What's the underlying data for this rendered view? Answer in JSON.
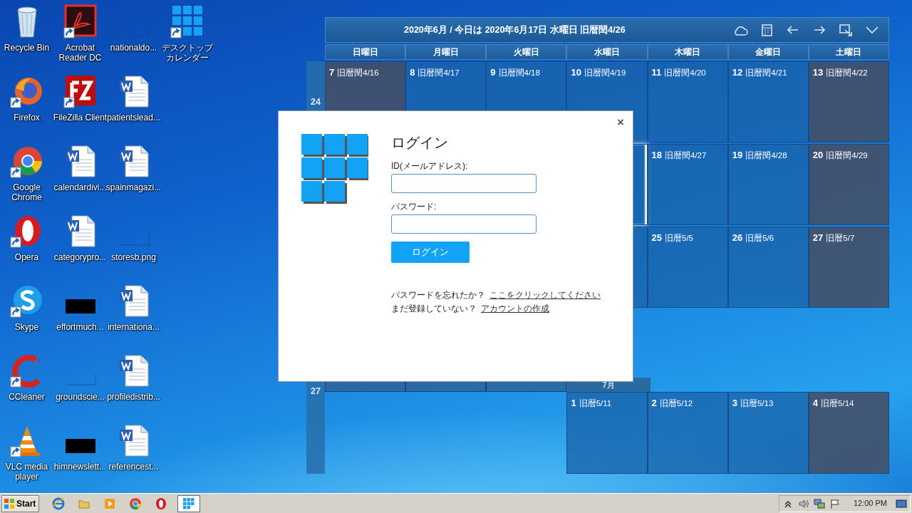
{
  "desktop_icons": [
    {
      "label": "Recycle Bin",
      "kind": "recycle",
      "shortcut": false
    },
    {
      "label": "Firefox",
      "kind": "firefox",
      "shortcut": true
    },
    {
      "label": "Google Chrome",
      "kind": "chrome",
      "shortcut": true
    },
    {
      "label": "Opera",
      "kind": "opera",
      "shortcut": true
    },
    {
      "label": "Skype",
      "kind": "skype",
      "shortcut": true
    },
    {
      "label": "CCleaner",
      "kind": "ccleaner",
      "shortcut": true
    },
    {
      "label": "VLC media player",
      "kind": "vlc",
      "shortcut": true
    },
    {
      "label": "Acrobat Reader DC",
      "kind": "pdf",
      "shortcut": true
    },
    {
      "label": "FileZilla Client",
      "kind": "filezilla",
      "shortcut": true
    },
    {
      "label": "calendardivi...",
      "kind": "word",
      "shortcut": false
    },
    {
      "label": "categorypro...",
      "kind": "word",
      "shortcut": false
    },
    {
      "label": "effortmuch...",
      "kind": "black",
      "shortcut": false
    },
    {
      "label": "groundscie...",
      "kind": "blank",
      "shortcut": false
    },
    {
      "label": "himnewslett...",
      "kind": "black",
      "shortcut": false
    },
    {
      "label": "nationaldo...",
      "kind": "blank",
      "shortcut": false
    },
    {
      "label": "patientslead...",
      "kind": "word",
      "shortcut": false
    },
    {
      "label": "spainmagazi...",
      "kind": "word",
      "shortcut": false
    },
    {
      "label": "storesb.png",
      "kind": "blank",
      "shortcut": false
    },
    {
      "label": "internationa...",
      "kind": "word",
      "shortcut": false
    },
    {
      "label": "profiledistrib...",
      "kind": "word",
      "shortcut": false
    },
    {
      "label": "referencest...",
      "kind": "word",
      "shortcut": false
    },
    {
      "label": "デスクトップカレンダー",
      "kind": "grid",
      "shortcut": true
    }
  ],
  "calendar": {
    "title": "2020年6月 / 今日は 2020年6月17日 水曜日 旧暦閏4/26",
    "weekdays": [
      "日曜日",
      "月曜日",
      "火曜日",
      "水曜日",
      "木曜日",
      "金曜日",
      "土曜日"
    ],
    "weeks": [
      {
        "week": "24",
        "strip": false,
        "days": [
          {
            "kind": "day",
            "day": "7",
            "lunar": "旧暦閏4/16",
            "weekend": true
          },
          {
            "kind": "day",
            "day": "8",
            "lunar": "旧暦閏4/17",
            "weekend": false
          },
          {
            "kind": "day",
            "day": "9",
            "lunar": "旧暦閏4/18",
            "weekend": false
          },
          {
            "kind": "day",
            "day": "10",
            "lunar": "旧暦閏4/19",
            "weekend": false
          },
          {
            "kind": "day",
            "day": "11",
            "lunar": "旧暦閏4/20",
            "weekend": false
          },
          {
            "kind": "day",
            "day": "12",
            "lunar": "旧暦閏4/21",
            "weekend": false
          },
          {
            "kind": "day",
            "day": "13",
            "lunar": "旧暦閏4/22",
            "weekend": true
          }
        ]
      },
      {
        "strip": false,
        "days": [
          {
            "kind": "covered"
          },
          {
            "kind": "covered"
          },
          {
            "kind": "covered"
          },
          {
            "kind": "covered",
            "today": true
          },
          {
            "kind": "day",
            "day": "18",
            "lunar": "旧暦閏4/27",
            "weekend": false
          },
          {
            "kind": "day",
            "day": "19",
            "lunar": "旧暦閏4/28",
            "weekend": false
          },
          {
            "kind": "day",
            "day": "20",
            "lunar": "旧暦閏4/29",
            "weekend": true
          }
        ]
      },
      {
        "strip": false,
        "days": [
          {
            "kind": "covered"
          },
          {
            "kind": "covered"
          },
          {
            "kind": "covered"
          },
          {
            "kind": "covered"
          },
          {
            "kind": "day",
            "day": "25",
            "lunar": "旧暦5/5",
            "weekend": false
          },
          {
            "kind": "day",
            "day": "26",
            "lunar": "旧暦5/6",
            "weekend": false
          },
          {
            "kind": "day",
            "day": "27",
            "lunar": "旧暦5/7",
            "weekend": true
          }
        ]
      },
      {
        "week": "27",
        "strip": true,
        "days": [
          {
            "kind": "blank"
          },
          {
            "kind": "blank"
          },
          {
            "kind": "blank"
          },
          {
            "kind": "day",
            "day": "1",
            "lunar": "旧暦5/11",
            "weekend": false,
            "month_label": "7月"
          },
          {
            "kind": "day",
            "day": "2",
            "lunar": "旧暦5/12",
            "weekend": false
          },
          {
            "kind": "day",
            "day": "3",
            "lunar": "旧暦5/13",
            "weekend": false
          },
          {
            "kind": "day",
            "day": "4",
            "lunar": "旧暦5/14",
            "weekend": true
          }
        ]
      }
    ]
  },
  "login": {
    "close": "×",
    "title": "ログイン",
    "fields": [
      {
        "label": "ID(メールアドレス):"
      },
      {
        "label": "パスワード:"
      }
    ],
    "button": "ログイン",
    "help": [
      {
        "text": "パスワードを忘れたか？",
        "link": "ここをクリックしてください"
      },
      {
        "text": "まだ登録していない？",
        "link": "アカウントの作成"
      }
    ]
  },
  "taskbar": {
    "start": "Start",
    "apps": [
      {
        "kind": "ie",
        "active": false
      },
      {
        "kind": "folder",
        "active": false
      },
      {
        "kind": "media",
        "active": false
      },
      {
        "kind": "chrome",
        "active": false
      },
      {
        "kind": "opera",
        "active": false
      },
      {
        "kind": "grid",
        "active": true
      }
    ],
    "time": "12:00 PM"
  }
}
